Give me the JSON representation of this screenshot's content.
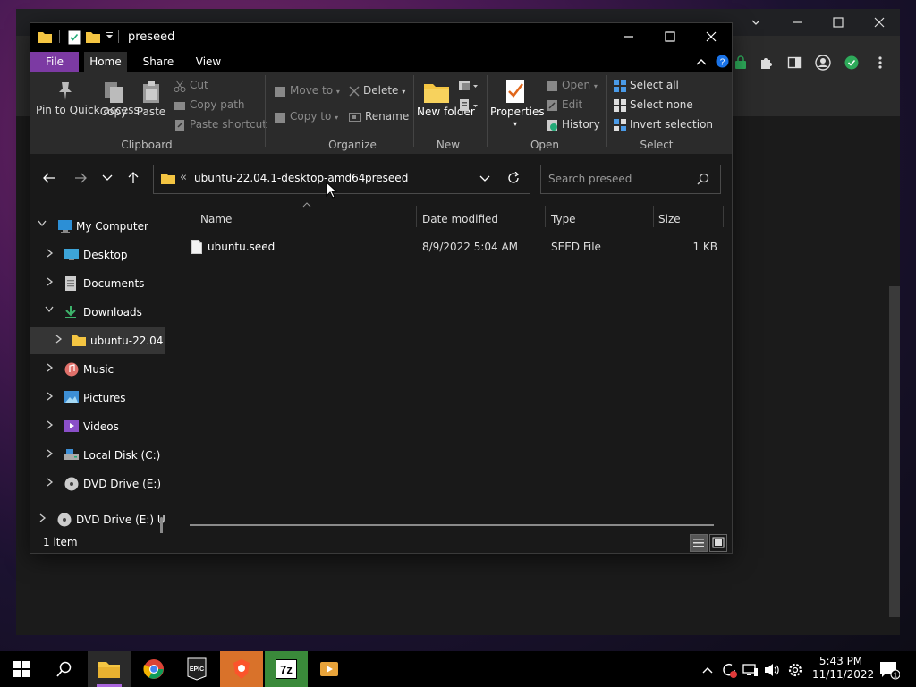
{
  "explorer": {
    "title": "preseed",
    "ribbon_tabs": [
      "File",
      "Home",
      "Share",
      "View"
    ],
    "ribbon": {
      "clipboard": {
        "pin": "Pin to Quick access",
        "copy": "Copy",
        "paste": "Paste",
        "cut": "Cut",
        "copy_path": "Copy path",
        "paste_shortcut": "Paste shortcut",
        "group": "Clipboard"
      },
      "organize": {
        "move_to": "Move to",
        "copy_to": "Copy to",
        "delete": "Delete",
        "rename": "Rename",
        "group": "Organize"
      },
      "new": {
        "new_folder": "New folder",
        "group": "New"
      },
      "open": {
        "properties": "Properties",
        "open": "Open",
        "edit": "Edit",
        "history": "History",
        "group": "Open"
      },
      "select": {
        "select_all": "Select all",
        "select_none": "Select none",
        "invert": "Invert selection",
        "group": "Select"
      }
    },
    "address": {
      "overflow": "«",
      "crumbs": [
        "ubuntu-22.04.1-desktop-amd64",
        "preseed"
      ]
    },
    "search_placeholder": "Search preseed",
    "nav_tree": [
      {
        "label": "My Computer",
        "icon": "computer-icon"
      },
      {
        "label": "Desktop",
        "icon": "desktop-icon"
      },
      {
        "label": "Documents",
        "icon": "documents-icon"
      },
      {
        "label": "Downloads",
        "icon": "downloads-icon"
      },
      {
        "label": "ubuntu-22.04",
        "icon": "folder-icon"
      },
      {
        "label": "Music",
        "icon": "music-icon"
      },
      {
        "label": "Pictures",
        "icon": "pictures-icon"
      },
      {
        "label": "Videos",
        "icon": "videos-icon"
      },
      {
        "label": "Local Disk (C:)",
        "icon": "disk-icon"
      },
      {
        "label": "DVD Drive (E:) U",
        "icon": "dvd-icon"
      },
      {
        "label": "DVD Drive (E:) Ub",
        "icon": "dvd-icon"
      }
    ],
    "columns": [
      "Name",
      "Date modified",
      "Type",
      "Size"
    ],
    "files": [
      {
        "name": "ubuntu.seed",
        "date": "8/9/2022 5:04 AM",
        "type": "SEED File",
        "size": "1 KB"
      }
    ],
    "status": "1 item"
  },
  "taskbar": {
    "apps": [
      "start-icon",
      "search-icon",
      "file-explorer-icon",
      "chrome-icon",
      "epic-games-icon",
      "brave-icon",
      "7zip-icon",
      "media-player-icon"
    ],
    "epic_label": "EPIC",
    "sevenzip_label": "7z",
    "time": "5:43 PM",
    "date": "11/11/2022",
    "notifications": "1"
  },
  "colors": {
    "file_tab": "#7c3aa3",
    "ribbon_bg": "#2b2b2b",
    "window_bg": "#191919",
    "folder": "#f4c542"
  }
}
